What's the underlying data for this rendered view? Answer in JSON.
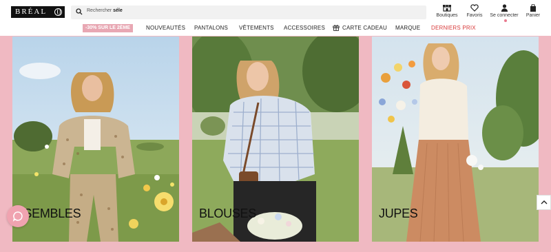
{
  "header": {
    "logo": "BRÉAL",
    "search": {
      "placeholder_prefix": "Rechercher ",
      "query": "séle"
    },
    "icons": [
      {
        "label": "Boutiques",
        "icon": "store-icon"
      },
      {
        "label": "Favoris",
        "icon": "heart-icon"
      },
      {
        "label": "Se connecter",
        "icon": "user-icon"
      },
      {
        "label": "Panier",
        "icon": "bag-icon"
      }
    ]
  },
  "nav": {
    "promo": "-30% SUR LE 2ÈME",
    "items": [
      "NOUVEAUTÉS",
      "PANTALONS",
      "VÊTEMENTS",
      "ACCESSOIRES",
      "CARTE CADEAU",
      "MARQUE",
      "DERNIERS PRIX"
    ]
  },
  "cards": [
    {
      "label": "ENSEMBLES"
    },
    {
      "label": "BLOUSES"
    },
    {
      "label": "JUPES"
    }
  ],
  "colors": {
    "background": "#f0b9c2",
    "promo_bg": "#e8a7b3",
    "sale_red": "#d83a3a",
    "chat": "#f0a3b0"
  }
}
